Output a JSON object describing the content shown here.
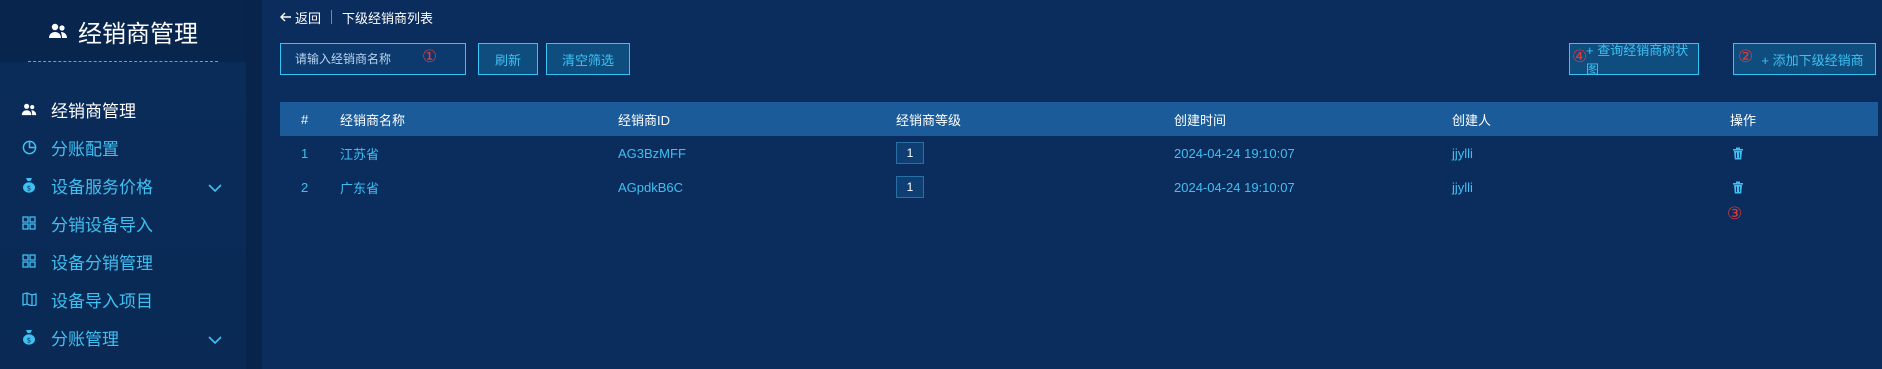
{
  "sidebar": {
    "title": "经销商管理",
    "items": [
      {
        "label": "经销商管理",
        "icon": "users-icon",
        "active": true
      },
      {
        "label": "分账配置",
        "icon": "pie-chart-icon"
      },
      {
        "label": "设备服务价格",
        "icon": "money-bag-icon",
        "expandable": true
      },
      {
        "label": "分销设备导入",
        "icon": "grid-icon"
      },
      {
        "label": "设备分销管理",
        "icon": "grid-icon"
      },
      {
        "label": "设备导入项目",
        "icon": "map-icon"
      },
      {
        "label": "分账管理",
        "icon": "money-bag-icon",
        "expandable": true
      }
    ]
  },
  "breadcrumb": {
    "back": "返回",
    "title": "下级经销商列表"
  },
  "toolbar": {
    "search_placeholder": "请输入经销商名称",
    "refresh": "刷新",
    "clear_filter": "清空筛选",
    "query_tree": "+ 查询经销商树状图",
    "add_sub": "+ 添加下级经销商"
  },
  "markers": {
    "m1": "①",
    "m2": "②",
    "m3": "③",
    "m4": "④"
  },
  "table": {
    "headers": [
      "#",
      "经销商名称",
      "经销商ID",
      "经销商等级",
      "创建时间",
      "创建人",
      "操作"
    ],
    "rows": [
      {
        "index": "1",
        "name": "江苏省",
        "id": "AG3BzMFF",
        "level": "1",
        "created": "2024-04-24 19:10:07",
        "creator": "jjylli"
      },
      {
        "index": "2",
        "name": "广东省",
        "id": "AGpdkB6C",
        "level": "1",
        "created": "2024-04-24 19:10:07",
        "creator": "jjylli"
      }
    ]
  },
  "colors": {
    "accent": "#3ec0f2",
    "marker": "#e23a3a",
    "header_bg": "#1b5b99",
    "background": "#0b2d5e"
  }
}
